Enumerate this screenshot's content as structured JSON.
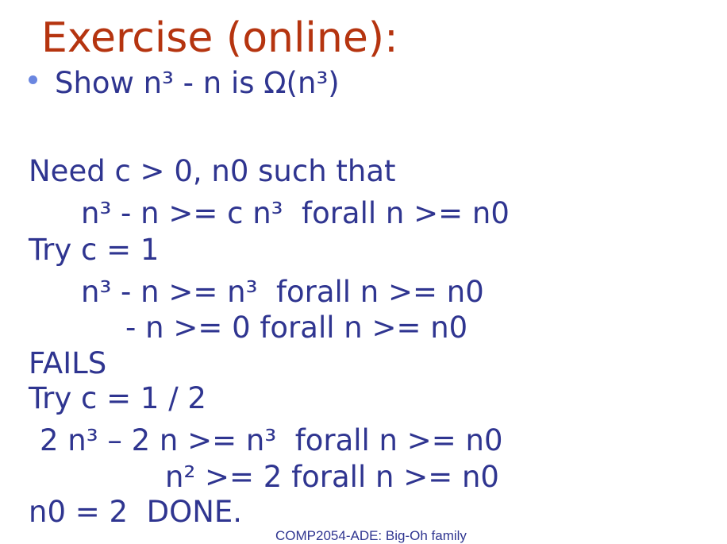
{
  "slide": {
    "title": "Exercise (online):",
    "bullet": "Show n³ - n  is  Ω(n³)",
    "lines": [
      "Need c > 0, n0 such that",
      "n³ - n >= c n³  forall n >= n0",
      "Try c = 1",
      "n³ - n >= n³  forall n >= n0",
      "- n >= 0 forall n >= n0",
      "FAILS",
      "Try c = 1 / 2",
      "2 n³ – 2 n >= n³  forall n >= n0",
      "n² >= 2 forall n >= n0",
      "n0 = 2  DONE."
    ],
    "footer": "COMP2054-ADE: Big-Oh family"
  },
  "colors": {
    "title": "#b5340f",
    "text": "#2f3590",
    "bullet": "#6a86e0"
  }
}
